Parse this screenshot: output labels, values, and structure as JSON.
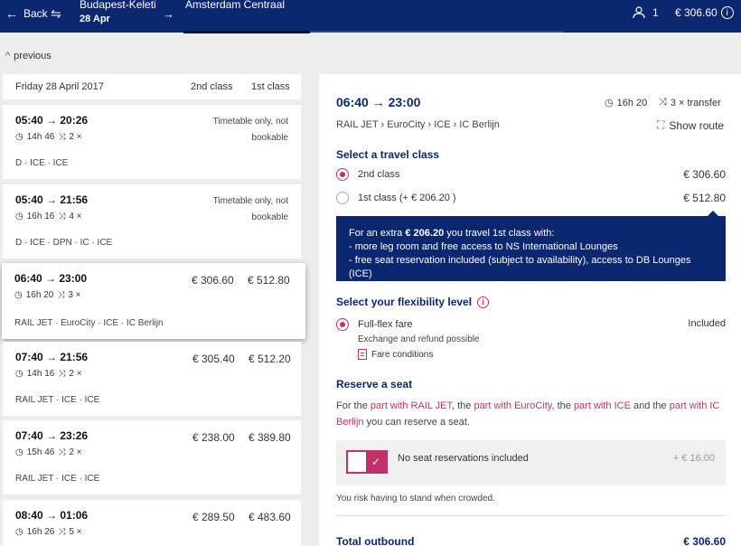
{
  "header": {
    "back_label": "Back",
    "from_station": "Budapest-Keleti",
    "date": "28 Apr",
    "to_station": "Amsterdam Centraal",
    "passengers": "1",
    "total_price": "€ 306.60"
  },
  "list": {
    "previous_label": "previous",
    "date_label": "Friday 28 April 2017",
    "col_2nd": "2nd class",
    "col_1st": "1st class",
    "journeys": [
      {
        "times": "05:40 → 20:26",
        "duration": "14h 46",
        "transfers": "2 ×",
        "trains": "D · ICE · ICE",
        "note": "Timetable only, not bookable",
        "price_2nd": "",
        "price_1st": ""
      },
      {
        "times": "05:40 → 21:56",
        "duration": "16h 16",
        "transfers": "4 ×",
        "trains": "D · ICE · DPN · IC · ICE",
        "note": "Timetable only, not bookable",
        "price_2nd": "",
        "price_1st": ""
      },
      {
        "times": "06:40 → 23:00",
        "duration": "16h 20",
        "transfers": "3 ×",
        "trains": "RAIL JET · EuroCity · ICE · IC Berlijn",
        "note": "",
        "price_2nd": "€ 306.60",
        "price_1st": "€ 512.80"
      },
      {
        "times": "07:40 → 21:56",
        "duration": "14h 16",
        "transfers": "2 ×",
        "trains": "RAIL JET · ICE · ICE",
        "note": "",
        "price_2nd": "€ 305.40",
        "price_1st": "€ 512.20"
      },
      {
        "times": "07:40 → 23:26",
        "duration": "15h 46",
        "transfers": "2 ×",
        "trains": "RAIL JET · ICE · ICE",
        "note": "",
        "price_2nd": "€ 238.00",
        "price_1st": "€ 389.80"
      },
      {
        "times": "08:40 → 01:06",
        "duration": "16h 26",
        "transfers": "5 ×",
        "trains": "",
        "note": "",
        "price_2nd": "€ 289.50",
        "price_1st": "€ 483.60"
      }
    ]
  },
  "detail": {
    "times": "06:40 → 23:00",
    "duration": "16h 20",
    "transfers": "3 × transfer",
    "trains": "RAIL JET › EuroCity › ICE › IC Berlijn",
    "show_route": "Show route",
    "class_heading": "Select a travel class",
    "class_2nd_label": "2nd class",
    "class_2nd_price": "€ 306.60",
    "class_1st_label": "1st class (+ € 206.20 )",
    "class_1st_price": "€ 512.80",
    "upsell_intro": "For an extra",
    "upsell_amount": "€ 206.20",
    "upsell_rest": "you travel 1st class with:",
    "upsell_line1": "- more leg room and free access to NS International Lounges",
    "upsell_line2": "- free seat reservation included (subject to availability), access to DB Lounges (ICE)",
    "flex_heading": "Select your flexibility level",
    "flex_label": "Full-flex fare",
    "flex_included": "Included",
    "flex_sub": "Exchange and refund possible",
    "fare_conditions": "Fare conditions",
    "seat_heading": "Reserve a seat",
    "seat_text": {
      "t1": "For the",
      "l1": "part with RAIL JET",
      "t2": ", the",
      "l2": "part with EuroCity",
      "t3": ", the",
      "l3": "part with ICE",
      "t4": "and the",
      "l4": "part with IC Berlijn",
      "t5": "you can reserve a seat."
    },
    "seat_toggle_label": "No seat reservations included",
    "seat_price": "+ € 16.00",
    "risk_note": "You risk having to stand when crowded.",
    "total_label": "Total outbound",
    "total_price": "€ 306.60"
  },
  "colors": {
    "navy": "#0b2770",
    "accent": "#c0306a",
    "background": "#ededed"
  }
}
